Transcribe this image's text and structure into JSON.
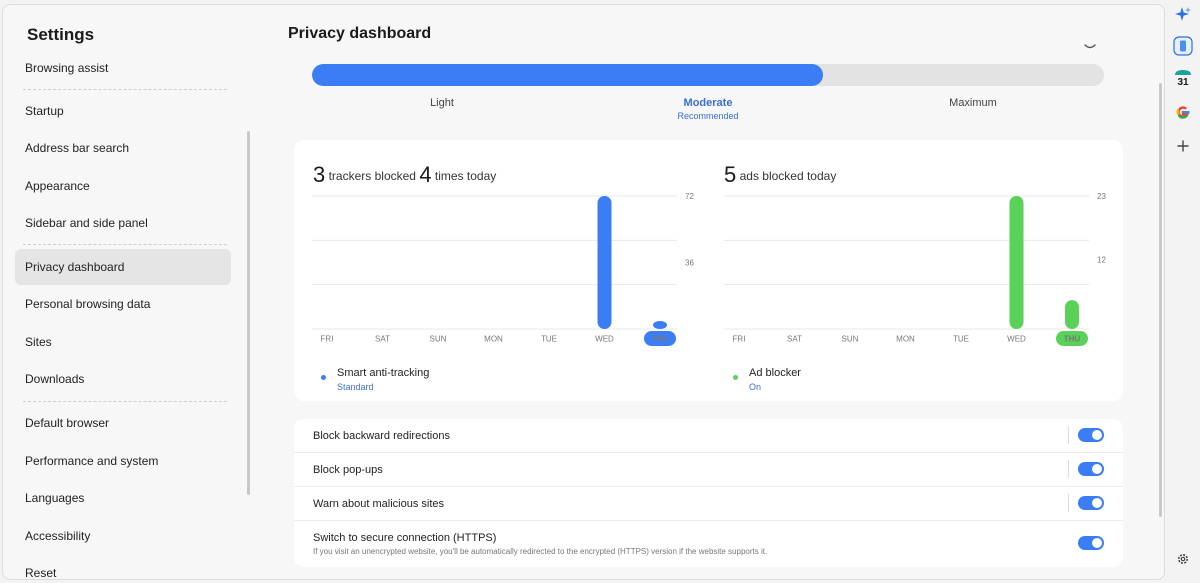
{
  "sidebar": {
    "title": "Settings",
    "items": [
      {
        "label": "Browsing assist"
      },
      {
        "label": "Startup"
      },
      {
        "label": "Address bar search"
      },
      {
        "label": "Appearance"
      },
      {
        "label": "Sidebar and side panel"
      },
      {
        "label": "Privacy dashboard",
        "active": true
      },
      {
        "label": "Personal browsing data"
      },
      {
        "label": "Sites"
      },
      {
        "label": "Downloads"
      },
      {
        "label": "Default browser"
      },
      {
        "label": "Performance and system"
      },
      {
        "label": "Languages"
      },
      {
        "label": "Accessibility"
      },
      {
        "label": "Reset"
      }
    ]
  },
  "main": {
    "title": "Privacy dashboard",
    "protection": {
      "levels": [
        "Light",
        "Moderate",
        "Maximum"
      ],
      "selected": "Moderate",
      "selected_sub": "Recommended",
      "fill_fraction": 0.645
    }
  },
  "stats": {
    "trackers": {
      "count": "3",
      "text1": "trackers blocked",
      "times": "4",
      "text2": "times today",
      "legend_title": "Smart anti-tracking",
      "legend_sub": "Standard",
      "color": "#3b7df5"
    },
    "ads": {
      "count": "5",
      "text1": "ads blocked today",
      "legend_title": "Ad blocker",
      "legend_sub": "On",
      "color": "#5ad25a"
    }
  },
  "chart_data": [
    {
      "type": "bar",
      "categories": [
        "FRI",
        "SAT",
        "SUN",
        "MON",
        "TUE",
        "WED",
        "THU"
      ],
      "values": [
        0,
        0,
        0,
        0,
        0,
        72,
        4
      ],
      "y_ticks": [
        "36",
        "72"
      ],
      "ylim": [
        0,
        72
      ],
      "highlight": "THU",
      "color": "#3b7df5"
    },
    {
      "type": "bar",
      "categories": [
        "FRI",
        "SAT",
        "SUN",
        "MON",
        "TUE",
        "WED",
        "THU"
      ],
      "values": [
        0,
        0,
        0,
        0,
        0,
        23,
        5
      ],
      "y_ticks": [
        "12",
        "23"
      ],
      "ylim": [
        0,
        23
      ],
      "highlight": "THU",
      "color": "#5ad25a"
    }
  ],
  "toggles": [
    {
      "label": "Block backward redirections",
      "on": true
    },
    {
      "label": "Block pop-ups",
      "on": true
    },
    {
      "label": "Warn about malicious sites",
      "on": true
    },
    {
      "label": "Switch to secure connection (HTTPS)",
      "desc": "If you visit an unencrypted website, you'll be automatically redirected to the encrypted (HTTPS) version if the website supports it.",
      "on": true
    }
  ],
  "rail": {
    "calendar_day": "31",
    "icons": [
      "sparkle-icon",
      "phone-icon",
      "calendar-icon",
      "google-icon",
      "add-icon",
      "settings-icon"
    ]
  }
}
